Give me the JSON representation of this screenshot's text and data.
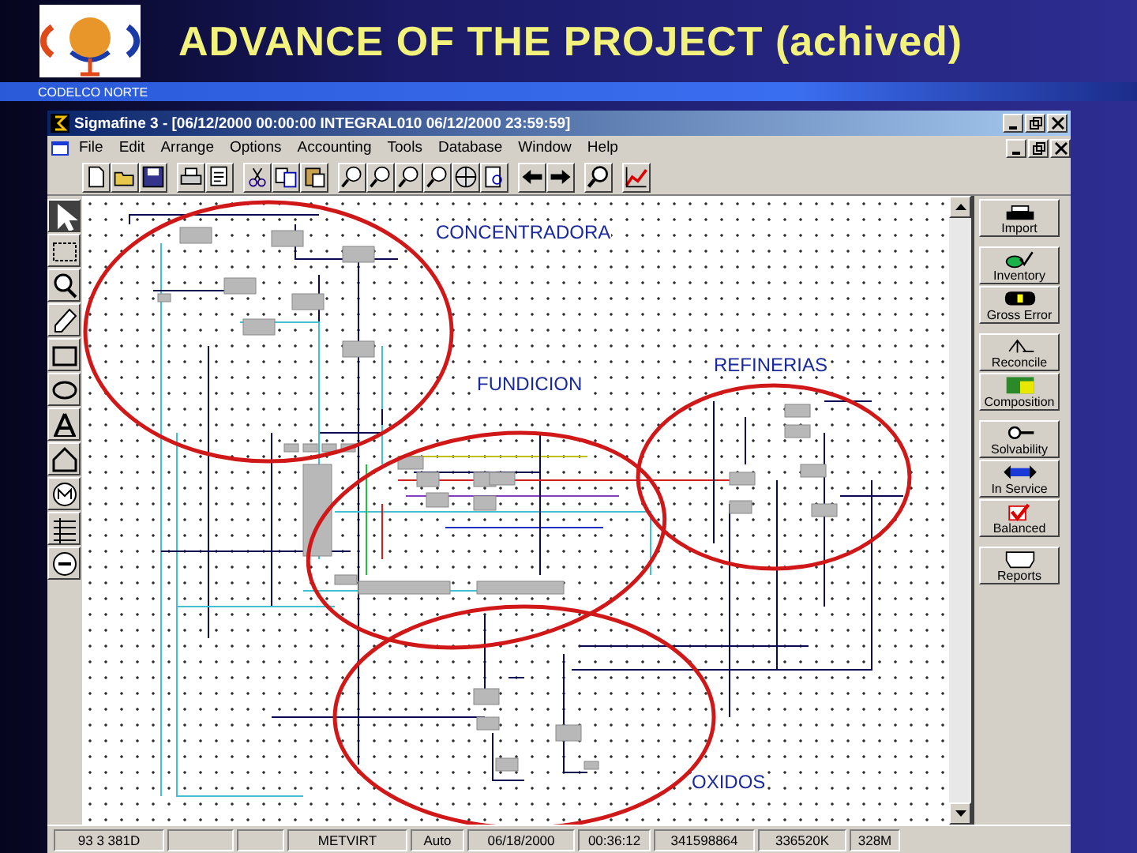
{
  "slide": {
    "title": "ADVANCE OF THE PROJECT (achived)",
    "subtitle": "CODELCO NORTE"
  },
  "window": {
    "title": "Sigmafine 3 - [06/12/2000 00:00:00  INTEGRAL010  06/12/2000 23:59:59]"
  },
  "menu": [
    "File",
    "Edit",
    "Arrange",
    "Options",
    "Accounting",
    "Tools",
    "Database",
    "Window",
    "Help"
  ],
  "canvas": {
    "areas": [
      {
        "label": "CONCENTRADORA"
      },
      {
        "label": "FUNDICION"
      },
      {
        "label": "REFINERIAS"
      },
      {
        "label": "OXIDOS"
      }
    ]
  },
  "side_button_groups": [
    [
      "Import"
    ],
    [
      "Inventory",
      "Gross Error"
    ],
    [
      "Reconcile",
      "Composition"
    ],
    [
      "Solvability",
      "In Service",
      "Balanced"
    ],
    [
      "Reports"
    ]
  ],
  "status_bar": [
    "93 3 381D",
    "METVIRT",
    "Auto",
    "06/18/2000",
    "00:36:12",
    "341598864",
    "336520K",
    "328M"
  ]
}
